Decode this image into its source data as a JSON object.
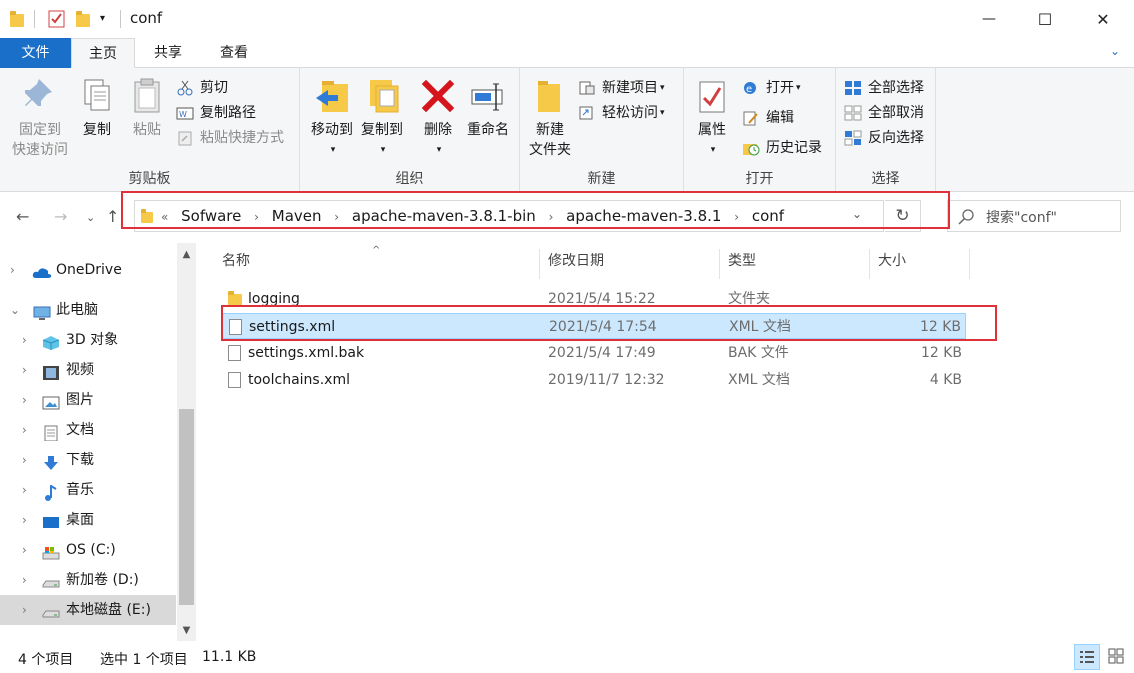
{
  "window": {
    "title": "conf",
    "minimize_glyph": "—",
    "maximize_glyph": "☐",
    "close_glyph": "✕"
  },
  "menu_tabs": [
    {
      "label": "文件"
    },
    {
      "label": "主页"
    },
    {
      "label": "共享"
    },
    {
      "label": "查看"
    }
  ],
  "ribbon": {
    "clipboard": {
      "label": "剪贴板",
      "pin_label_1": "固定到",
      "pin_label_2": "快速访问",
      "copy": "复制",
      "paste": "粘贴",
      "cut": "剪切",
      "copy_path": "复制路径",
      "paste_shortcut": "粘贴快捷方式"
    },
    "organize": {
      "label": "组织",
      "move_to": "移动到",
      "copy_to": "复制到",
      "delete": "删除",
      "rename": "重命名"
    },
    "new": {
      "label": "新建",
      "new_folder_1": "新建",
      "new_folder_2": "文件夹",
      "new_item": "新建项目",
      "easy_access": "轻松访问"
    },
    "open": {
      "label": "打开",
      "properties": "属性",
      "open": "打开",
      "edit": "编辑",
      "history": "历史记录"
    },
    "select": {
      "label": "选择",
      "select_all": "全部选择",
      "select_none": "全部取消",
      "invert": "反向选择"
    }
  },
  "address": {
    "overflow": "«",
    "crumbs": [
      "Sofware",
      "Maven",
      "apache-maven-3.8.1-bin",
      "apache-maven-3.8.1",
      "conf"
    ],
    "separator": "›",
    "search_placeholder": "搜索\"conf\""
  },
  "nav_pane": {
    "items": [
      {
        "label": "OneDrive",
        "icon": "cloud-icon"
      },
      {
        "label": "此电脑",
        "icon": "computer-icon"
      },
      {
        "label": "3D 对象",
        "icon": "cube-icon"
      },
      {
        "label": "视频",
        "icon": "video-icon"
      },
      {
        "label": "图片",
        "icon": "picture-icon"
      },
      {
        "label": "文档",
        "icon": "document-icon"
      },
      {
        "label": "下载",
        "icon": "download-icon"
      },
      {
        "label": "音乐",
        "icon": "music-icon"
      },
      {
        "label": "桌面",
        "icon": "desktop-icon"
      },
      {
        "label": "OS (C:)",
        "icon": "drive-c-icon"
      },
      {
        "label": "新加卷 (D:)",
        "icon": "drive-icon"
      },
      {
        "label": "本地磁盘 (E:)",
        "icon": "drive-icon"
      }
    ]
  },
  "file_list": {
    "columns": {
      "name": "名称",
      "modified": "修改日期",
      "type": "类型",
      "size": "大小"
    },
    "rows": [
      {
        "name": "logging",
        "modified": "2021/5/4 15:22",
        "type": "文件夹",
        "size": "",
        "icon": "folder-icon"
      },
      {
        "name": "settings.xml",
        "modified": "2021/5/4 17:54",
        "type": "XML 文档",
        "size": "12 KB",
        "icon": "file-icon"
      },
      {
        "name": "settings.xml.bak",
        "modified": "2021/5/4 17:49",
        "type": "BAK 文件",
        "size": "12 KB",
        "icon": "file-icon"
      },
      {
        "name": "toolchains.xml",
        "modified": "2019/11/7 12:32",
        "type": "XML 文档",
        "size": "4 KB",
        "icon": "file-icon"
      }
    ]
  },
  "status": {
    "item_count": "4 个项目",
    "selection": "选中 1 个项目",
    "selection_size": "11.1 KB"
  },
  "colors": {
    "file_tab": "#1a6fc9",
    "selection_bg": "#cce8ff",
    "annotation_red": "#e0303a",
    "folder": "#f7c948"
  }
}
